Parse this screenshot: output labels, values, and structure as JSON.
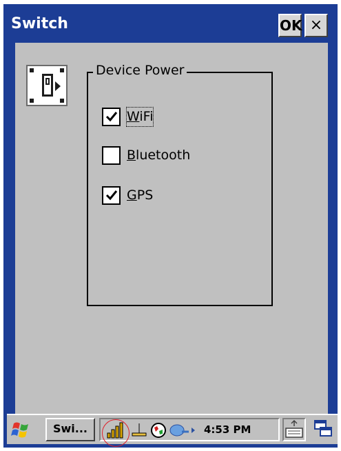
{
  "window": {
    "title": "Switch",
    "ok_label": "OK",
    "close_label": "×"
  },
  "group": {
    "label": "Device Power",
    "items": [
      {
        "label": "WiFi",
        "mnemonic": "W",
        "checked": true,
        "focused": true
      },
      {
        "label": "Bluetooth",
        "mnemonic": "B",
        "checked": false,
        "focused": false
      },
      {
        "label": "GPS",
        "mnemonic": "G",
        "checked": true,
        "focused": false
      }
    ]
  },
  "taskbar": {
    "task_label": "Swi...",
    "clock": "4:53 PM",
    "icons": [
      "windows-start-icon",
      "signal-strength-icon",
      "network-connection-icon",
      "globe-icon",
      "activesync-icon",
      "keyboard-icon",
      "desktop-switch-icon"
    ]
  },
  "colors": {
    "title_bar": "#1c3d95",
    "client_bg": "#c0c0c0",
    "highlight_circle": "#e0202a"
  }
}
